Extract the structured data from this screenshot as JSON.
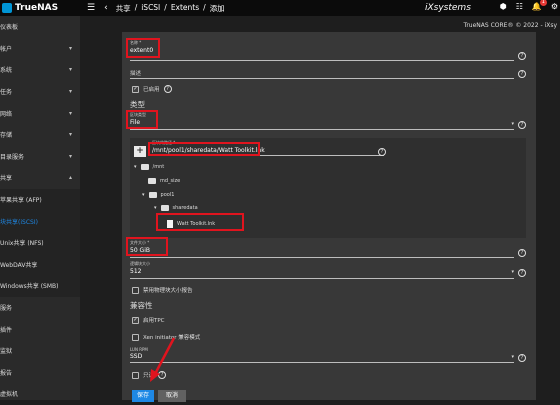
{
  "topbar": {
    "brand": "TrueNAS",
    "menu_icon": "hamburger-icon",
    "back_icon": "chevron-left-icon",
    "breadcrumb": [
      "共享",
      "/",
      "iSCSI",
      "/",
      "Extents",
      "/",
      "添加"
    ],
    "ix_logo": "iXsystems",
    "notif_count": "1",
    "version": "TrueNAS CORE® © 2022 - iXsy"
  },
  "sidebar": {
    "items": [
      {
        "label": "仪表板",
        "chev": ""
      },
      {
        "label": "帐户",
        "chev": "▾"
      },
      {
        "label": "系统",
        "chev": "▾"
      },
      {
        "label": "任务",
        "chev": "▾"
      },
      {
        "label": "网络",
        "chev": "▾"
      },
      {
        "label": "存储",
        "chev": "▾"
      },
      {
        "label": "目录服务",
        "chev": "▾"
      },
      {
        "label": "共享",
        "chev": "▴"
      },
      {
        "label": "苹果共享 (AFP)",
        "chev": ""
      },
      {
        "label": "块共享(iSCSI)",
        "chev": ""
      },
      {
        "label": "Unix共享 (NFS)",
        "chev": ""
      },
      {
        "label": "WebDAV共享",
        "chev": ""
      },
      {
        "label": "Windows共享 (SMB)",
        "chev": ""
      },
      {
        "label": "服务",
        "chev": ""
      },
      {
        "label": "插件",
        "chev": ""
      },
      {
        "label": "监狱",
        "chev": ""
      },
      {
        "label": "报告",
        "chev": ""
      },
      {
        "label": "虚拟机",
        "chev": ""
      }
    ]
  },
  "form": {
    "name_label": "名称 *",
    "name_value": "extent0",
    "desc_label": "描述",
    "enabled_label": "已启用",
    "type_section": "类型",
    "extent_type_label": "区块类型",
    "extent_type_value": "File",
    "path_label": "区块的路径 *",
    "path_value": "/mnt/pool1/sharedata/Watt Toolkit.lnk",
    "tree": [
      "/mnt",
      "md_size",
      "pool1",
      "sharedata",
      "Watt Toolkit.lnk"
    ],
    "size_label": "文件大小 *",
    "size_value": "50 GiB",
    "logical_block_label": "逻辑块大小",
    "logical_block_value": "512",
    "disable_physical_label": "禁用物理块大小报告",
    "compat_section": "兼容性",
    "tpc_label": "启用TPC",
    "xen_label": "Xen initiator 兼容模式",
    "lun_rpm_label": "LUN RPM",
    "lun_rpm_value": "SSD",
    "readonly_label": "只读",
    "save_label": "保存",
    "cancel_label": "取消"
  },
  "colors": {
    "accent": "#1e88e5",
    "highlight_box": "#e0141e",
    "arrow": "#e0141e"
  }
}
